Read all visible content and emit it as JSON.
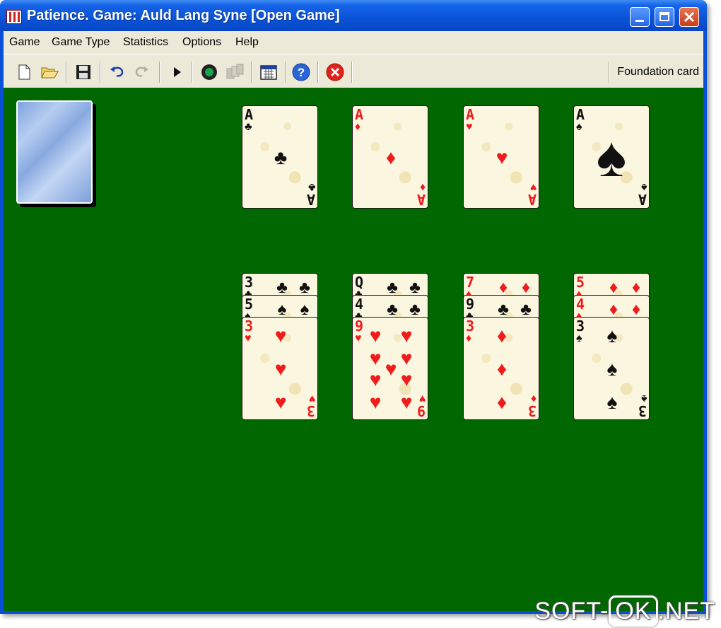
{
  "window": {
    "title": "Patience. Game: Auld Lang Syne  [Open Game]"
  },
  "menu": {
    "items": [
      "Game",
      "Game Type",
      "Statistics",
      "Options",
      "Help"
    ]
  },
  "toolbar": {
    "icons": [
      "new-icon",
      "open-folder-icon",
      "save-icon",
      "undo-icon",
      "redo-icon",
      "play-icon",
      "record-icon",
      "autoplay-icon",
      "calendar-icon",
      "help-icon",
      "stop-icon"
    ],
    "status_text": "Foundation card"
  },
  "foundations": [
    {
      "rank": "A",
      "suit": "♣",
      "color": "black"
    },
    {
      "rank": "A",
      "suit": "♦",
      "color": "red"
    },
    {
      "rank": "A",
      "suit": "♥",
      "color": "red"
    },
    {
      "rank": "A",
      "suit": "♠",
      "color": "black"
    }
  ],
  "tableau": [
    {
      "cards": [
        {
          "rank": "3",
          "suit": "♣",
          "color": "black"
        },
        {
          "rank": "5",
          "suit": "♠",
          "color": "black"
        },
        {
          "rank": "3",
          "suit": "♥",
          "color": "red"
        }
      ]
    },
    {
      "cards": [
        {
          "rank": "Q",
          "suit": "♣",
          "color": "black"
        },
        {
          "rank": "4",
          "suit": "♣",
          "color": "black"
        },
        {
          "rank": "9",
          "suit": "♥",
          "color": "red"
        }
      ]
    },
    {
      "cards": [
        {
          "rank": "7",
          "suit": "♦",
          "color": "red"
        },
        {
          "rank": "9",
          "suit": "♣",
          "color": "black"
        },
        {
          "rank": "3",
          "suit": "♦",
          "color": "red"
        }
      ]
    },
    {
      "cards": [
        {
          "rank": "5",
          "suit": "♦",
          "color": "red"
        },
        {
          "rank": "4",
          "suit": "♦",
          "color": "red"
        },
        {
          "rank": "3",
          "suit": "♠",
          "color": "black"
        }
      ]
    }
  ],
  "watermark": {
    "prefix": "SOFT-",
    "boxed": "OK",
    "suffix": ".NET"
  },
  "colors": {
    "felt": "#016700",
    "titlebar": "#0a53d6",
    "chrome": "#ece9d8"
  }
}
